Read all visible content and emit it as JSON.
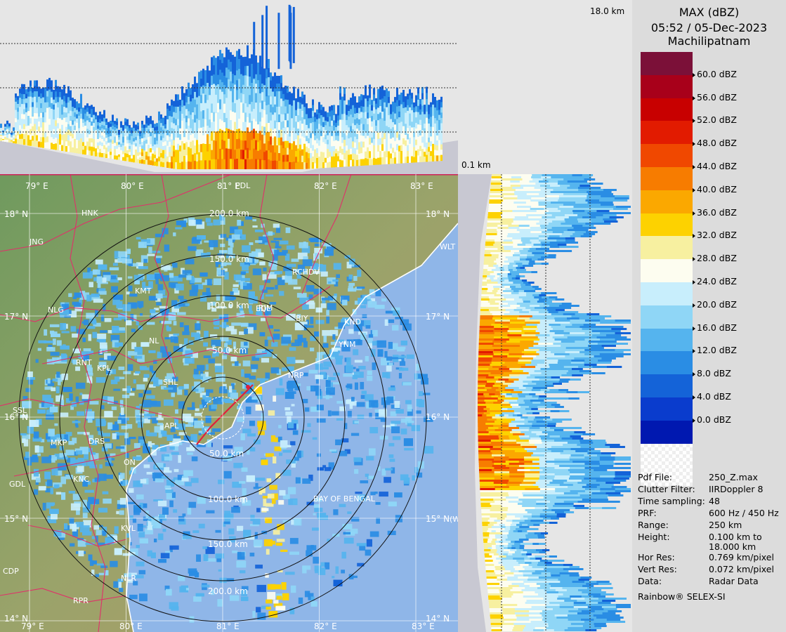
{
  "header": {
    "product": "MAX (dBZ)",
    "datetime": "05:52 / 05-Dec-2023",
    "station": "Machilipatnam"
  },
  "panels": {
    "top_height_label": "18.0 km",
    "side_height_label": "0.1 km"
  },
  "colorbar": {
    "unit": "dBZ",
    "labels": [
      "60.0 dBZ",
      "56.0 dBZ",
      "52.0 dBZ",
      "48.0 dBZ",
      "44.0 dBZ",
      "40.0 dBZ",
      "36.0 dBZ",
      "32.0 dBZ",
      "28.0 dBZ",
      "24.0 dBZ",
      "20.0 dBZ",
      "16.0 dBZ",
      "12.0 dBZ",
      "8.0 dBZ",
      "4.0 dBZ",
      "0.0 dBZ"
    ],
    "colors": [
      "#7b1038",
      "#a8001a",
      "#c80000",
      "#e21b00",
      "#f04800",
      "#f77c00",
      "#fba800",
      "#fdd200",
      "#f7f0a0",
      "#fdfdf0",
      "#c8eefc",
      "#8fd6f6",
      "#55b4ee",
      "#2a8de4",
      "#1463d8",
      "#0a3ccd",
      "#0018b0"
    ]
  },
  "info": [
    {
      "label": "Pdf File:",
      "value": "250_Z.max"
    },
    {
      "label": "Clutter Filter:",
      "value": "IIRDoppler 8"
    },
    {
      "label": "Time sampling:",
      "value": "48"
    },
    {
      "label": "PRF:",
      "value": "600 Hz / 450 Hz"
    },
    {
      "label": "Range:",
      "value": "250 km"
    },
    {
      "label": "Height:",
      "value": "0.100 km to\n18.000 km"
    },
    {
      "label": "Hor Res:",
      "value": "0.769 km/pixel"
    },
    {
      "label": "Vert Res:",
      "value": "0.072 km/pixel"
    },
    {
      "label": "Data:",
      "value": "Radar Data"
    }
  ],
  "footer": "Rainbow® SELEX-SI",
  "map": {
    "lon_labels": [
      "79° E",
      "80° E",
      "81° E",
      "82° E",
      "83° E"
    ],
    "lat_labels": [
      "18° N",
      "17° N",
      "16° N",
      "15° N",
      "14° N"
    ],
    "range_rings": [
      "50.0 km",
      "100.0 km",
      "150.0 km",
      "200.0 km"
    ],
    "range_rings_south": [
      "50.0 km",
      "100.0 km",
      "150.0 km",
      "200.0 km"
    ],
    "places": [
      "JNG",
      "NLG",
      "KMT",
      "HNK",
      "RCHDV",
      "RJM",
      "BIY",
      "KND",
      "YNM",
      "NRP",
      "SSL",
      "MKP",
      "DRS",
      "GDL",
      "KNC",
      "ON",
      "RPR",
      "CDP",
      "NLR",
      "KVL",
      "BAY OF BENGAL",
      "(WEST CENTRAL)",
      "WLT",
      "NL",
      "RNT",
      "KPL",
      "EDL",
      "SHL",
      "APL",
      "PDL"
    ]
  }
}
